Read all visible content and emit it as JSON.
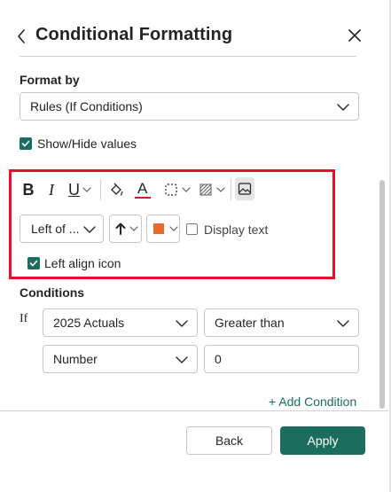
{
  "header": {
    "title": "Conditional Formatting"
  },
  "format_by": {
    "label": "Format by",
    "value": "Rules (If Conditions)"
  },
  "show_hide": {
    "label": "Show/Hide values",
    "checked": true
  },
  "toolbar": {
    "bold": "B",
    "italic": "I",
    "underline": "U",
    "font_color_letter": "A",
    "font_color": "#e8112d"
  },
  "icon_row": {
    "position_value": "Left of ...",
    "icon_color": "#e8692b",
    "display_text_label": "Display text",
    "display_text_checked": false
  },
  "left_align": {
    "label": "Left align icon",
    "checked": true
  },
  "conditions": {
    "label": "Conditions",
    "if_label": "If",
    "field": "2025 Actuals",
    "operator": "Greater than",
    "value_type": "Number",
    "value": "0",
    "add_label": "+ Add Condition"
  },
  "footer": {
    "back_label": "Back",
    "apply_label": "Apply"
  },
  "colors": {
    "accent": "#1b6d5e",
    "highlight_border": "#e8112d"
  }
}
